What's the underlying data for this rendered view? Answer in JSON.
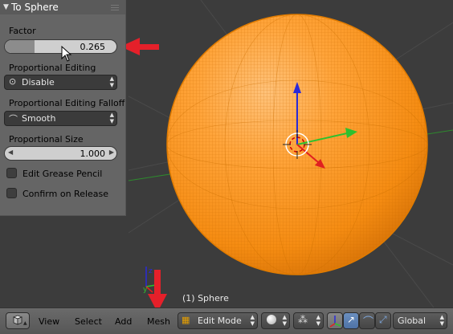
{
  "panel": {
    "title": "To Sphere",
    "factor": {
      "label": "Factor",
      "value": "0.265",
      "fraction": 0.265
    },
    "proportional_editing": {
      "label": "Proportional Editing",
      "value": "Disable"
    },
    "falloff": {
      "label": "Proportional Editing Falloff",
      "value": "Smooth"
    },
    "size": {
      "label": "Proportional Size",
      "value": "1.000"
    },
    "edit_grease_pencil": {
      "label": "Edit Grease Pencil",
      "checked": false
    },
    "confirm_on_release": {
      "label": "Confirm on Release",
      "checked": false
    }
  },
  "viewport": {
    "object_label": "(1) Sphere",
    "sphere_color": "#ff9a1e"
  },
  "header": {
    "menus": [
      "View",
      "Select",
      "Add",
      "Mesh"
    ],
    "mode": "Edit Mode",
    "orientation": "Global"
  },
  "colors": {
    "annotation_arrow": "#e5202a",
    "axis_x": "#e02020",
    "axis_y": "#2ec02e",
    "axis_z": "#2a2ad8"
  }
}
